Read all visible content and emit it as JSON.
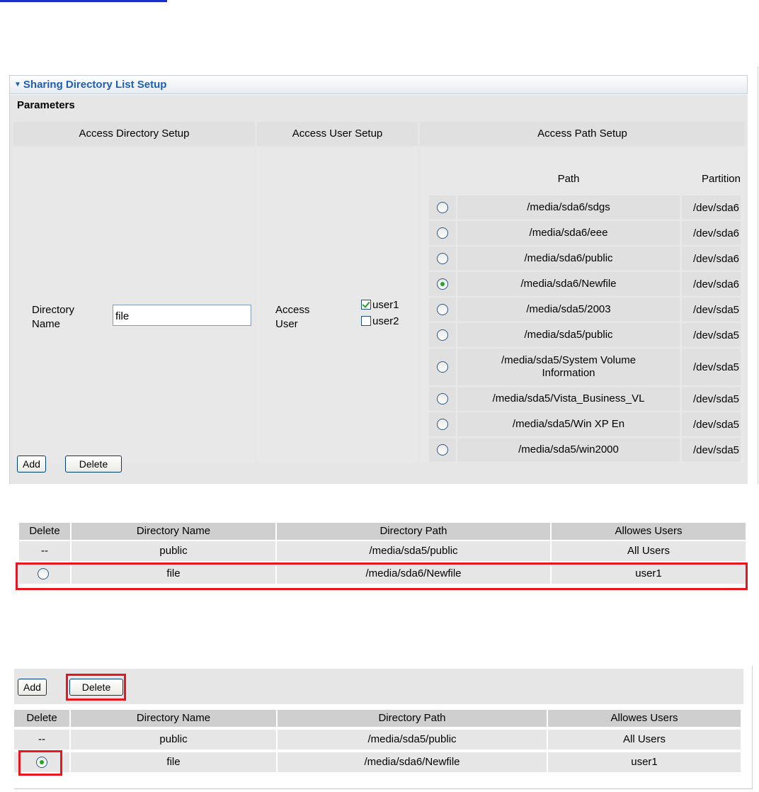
{
  "panel1": {
    "section_title": "Sharing Directory List Setup",
    "parameters_label": "Parameters",
    "columns": {
      "directory": "Access Directory Setup",
      "user": "Access User Setup",
      "path": "Access Path Setup"
    },
    "directory_name": {
      "label_line1": "Directory",
      "label_line2": "Name",
      "value": "file"
    },
    "access_user": {
      "label_line1": "Access",
      "label_line2": "User",
      "options": [
        {
          "label": "user1",
          "checked": true
        },
        {
          "label": "user2",
          "checked": false
        }
      ]
    },
    "path_table": {
      "path_header": "Path",
      "partition_header": "Partition",
      "rows": [
        {
          "path": "/media/sda6/sdgs",
          "partition": "/dev/sda6",
          "selected": false
        },
        {
          "path": "/media/sda6/eee",
          "partition": "/dev/sda6",
          "selected": false
        },
        {
          "path": "/media/sda6/public",
          "partition": "/dev/sda6",
          "selected": false
        },
        {
          "path": "/media/sda6/Newfile",
          "partition": "/dev/sda6",
          "selected": true
        },
        {
          "path": "/media/sda5/2003",
          "partition": "/dev/sda5",
          "selected": false
        },
        {
          "path": "/media/sda5/public",
          "partition": "/dev/sda5",
          "selected": false
        },
        {
          "path": "/media/sda5/System Volume Information",
          "partition": "/dev/sda5",
          "selected": false
        },
        {
          "path": "/media/sda5/Vista_Business_VL",
          "partition": "/dev/sda5",
          "selected": false
        },
        {
          "path": "/media/sda5/Win XP En",
          "partition": "/dev/sda5",
          "selected": false
        },
        {
          "path": "/media/sda5/win2000",
          "partition": "/dev/sda5",
          "selected": false
        }
      ]
    },
    "add_label": "Add",
    "delete_label": "Delete"
  },
  "list_table": {
    "headers": [
      "Delete",
      "Directory Name",
      "Directory Path",
      "Allowes Users"
    ],
    "rows": [
      {
        "delete": "--",
        "name": "public",
        "path": "/media/sda5/public",
        "users": "All Users"
      },
      {
        "delete": "radio",
        "name": "file",
        "path": "/media/sda6/Newfile",
        "users": "user1"
      }
    ]
  },
  "panel3": {
    "add_label": "Add",
    "delete_label": "Delete",
    "headers": [
      "Delete",
      "Directory Name",
      "Directory Path",
      "Allowes Users"
    ],
    "rows": [
      {
        "delete": "--",
        "name": "public",
        "path": "/media/sda5/public",
        "users": "All Users"
      },
      {
        "delete": "radio-selected",
        "name": "file",
        "path": "/media/sda6/Newfile",
        "users": "user1"
      }
    ]
  },
  "highlight_color": "#e8161f",
  "section_title_color": "#1e5fb4"
}
